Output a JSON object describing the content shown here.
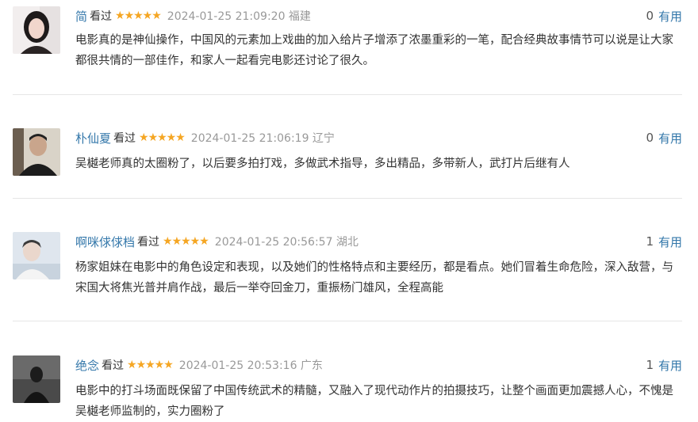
{
  "comments": [
    {
      "user": "简",
      "status": "看过",
      "stars": "★★★★★",
      "meta": "2024-01-25 21:09:20 福建",
      "useful_count": "0",
      "useful_label": "有用",
      "text": "电影真的是神仙操作，中国风的元素加上戏曲的加入给片子增添了浓墨重彩的一笔，配合经典故事情节可以说是让大家都很共情的一部佳作，和家人一起看完电影还讨论了很久。",
      "avatar_icon": "avatar-young-woman"
    },
    {
      "user": "朴仙夏",
      "status": "看过",
      "stars": "★★★★★",
      "meta": "2024-01-25 21:06:19 辽宁",
      "useful_count": "0",
      "useful_label": "有用",
      "text": "吴樾老师真的太圈粉了，以后要多拍打戏，多做武术指导，多出精品，多带新人，武打片后继有人",
      "avatar_icon": "avatar-older-man"
    },
    {
      "user": "啊咪俅俅档",
      "status": "看过",
      "stars": "★★★★★",
      "meta": "2024-01-25 20:56:57 湖北",
      "useful_count": "1",
      "useful_label": "有用",
      "text": "杨家姐妹在电影中的角色设定和表现，以及她们的性格特点和主要经历，都是看点。她们冒着生命危险，深入敌营，与宋国大将焦光普并肩作战，最后一举夺回金刀，重振杨门雄风，全程高能",
      "avatar_icon": "avatar-young-man"
    },
    {
      "user": "绝念",
      "status": "看过",
      "stars": "★★★★★",
      "meta": "2024-01-25 20:53:16 广东",
      "useful_count": "1",
      "useful_label": "有用",
      "text": "电影中的打斗场面既保留了中国传统武术的精髓，又融入了现代动作片的拍摄技巧，让整个画面更加震撼人心，不愧是吴樾老师监制的，实力圈粉了",
      "avatar_icon": "avatar-dark-silhouette"
    }
  ]
}
